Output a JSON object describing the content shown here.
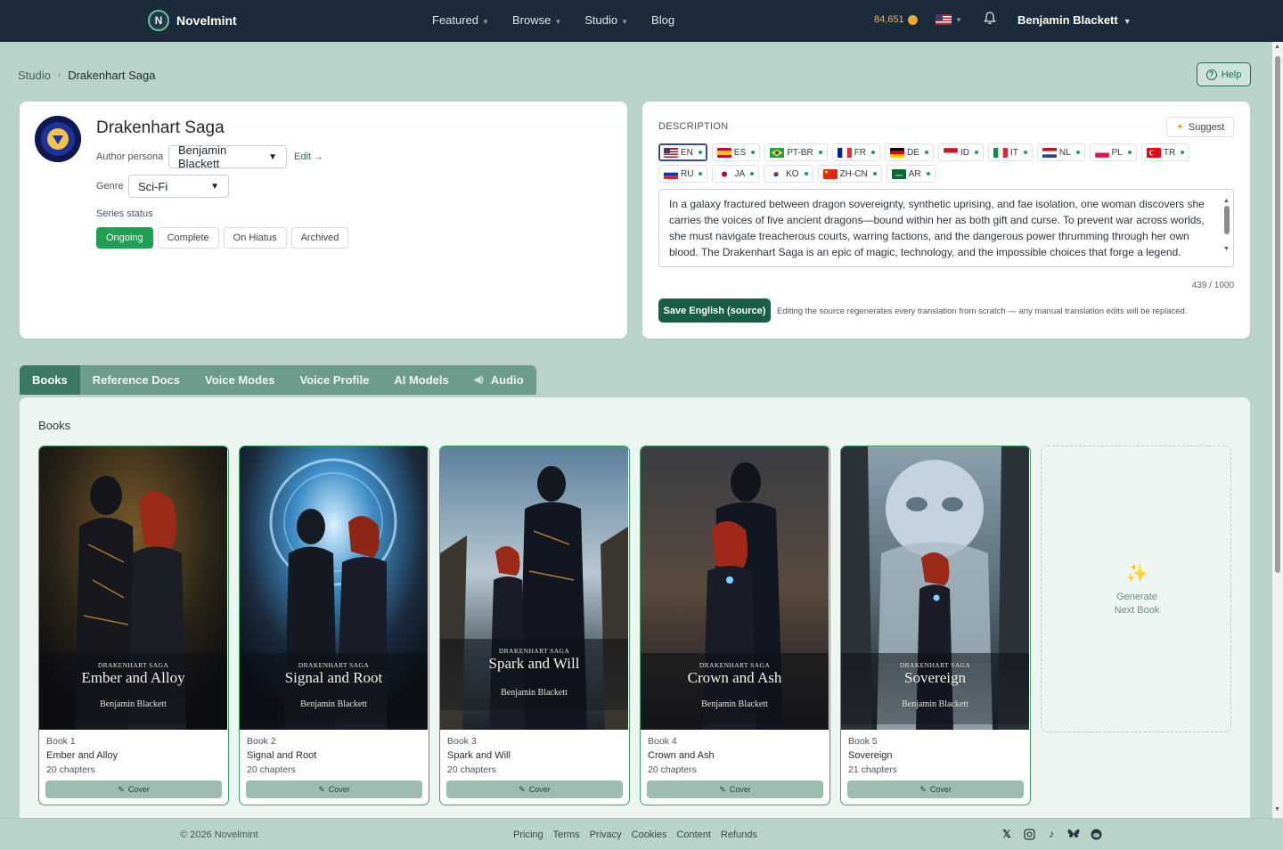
{
  "app": {
    "brand": "Novelmint",
    "logo_letter": "N"
  },
  "nav": {
    "links": [
      {
        "label": "Featured",
        "has_menu": true
      },
      {
        "label": "Browse",
        "has_menu": true
      },
      {
        "label": "Studio",
        "has_menu": true
      },
      {
        "label": "Blog",
        "has_menu": false
      }
    ],
    "coins": "84,651",
    "user": "Benjamin Blackett"
  },
  "breadcrumb": {
    "parent": "Studio",
    "current": "Drakenhart Saga"
  },
  "help_label": "Help",
  "series": {
    "title": "Drakenhart Saga",
    "author_persona_label": "Author persona",
    "author_persona_value": "Benjamin Blackett",
    "edit_label": "Edit →",
    "genre_label": "Genre",
    "genre_value": "Sci-Fi",
    "status_label": "Series status",
    "statuses": [
      "Ongoing",
      "Complete",
      "On Hiatus",
      "Archived"
    ],
    "active_status": "Ongoing"
  },
  "description": {
    "label": "DESCRIPTION",
    "suggest_label": "Suggest",
    "languages_row1": [
      "EN",
      "ES",
      "PT-BR",
      "FR",
      "DE",
      "ID",
      "IT",
      "NL",
      "PL",
      "TR"
    ],
    "languages_row2": [
      "RU",
      "JA",
      "KO",
      "ZH-CN",
      "AR"
    ],
    "active_language": "EN",
    "text": "In a galaxy fractured between dragon sovereignty, synthetic uprising, and fae isolation, one woman discovers she carries the voices of five ancient dragons—bound within her as both gift and curse. To prevent war across worlds, she must navigate treacherous courts, warring factions, and the dangerous power thrumming through her own blood. The Drakenhart Saga is an epic of magic, technology, and the impossible choices that forge a legend.",
    "char_count": "439 / 1000",
    "save_label": "Save English (source)",
    "save_note": "Editing the source regenerates every translation from scratch — any manual translation edits will be replaced."
  },
  "tabs": [
    "Books",
    "Reference Docs",
    "Voice Modes",
    "Voice Profile",
    "AI Models",
    "Audio"
  ],
  "active_tab": "Books",
  "books_heading": "Books",
  "books": [
    {
      "number": "Book 1",
      "title": "Ember and Alloy",
      "chapters": "20 chapters",
      "cover_saga": "DRAKENHART SAGA",
      "cover_title": "Ember and Alloy",
      "cover_author": "Benjamin Blackett"
    },
    {
      "number": "Book 2",
      "title": "Signal and Root",
      "chapters": "20 chapters",
      "cover_saga": "DRAKENHART SAGA",
      "cover_title": "Signal and Root",
      "cover_author": "Benjamin Blackett"
    },
    {
      "number": "Book 3",
      "title": "Spark and Will",
      "chapters": "20 chapters",
      "cover_saga": "DRAKENHART SAGA",
      "cover_title": "Spark and Will",
      "cover_author": "Benjamin Blackett"
    },
    {
      "number": "Book 4",
      "title": "Crown and Ash",
      "chapters": "20 chapters",
      "cover_saga": "DRAKENHART SAGA",
      "cover_title": "Crown and Ash",
      "cover_author": "Benjamin Blackett"
    },
    {
      "number": "Book 5",
      "title": "Sovereign",
      "chapters": "21 chapters",
      "cover_saga": "DRAKENHART SAGA",
      "cover_title": "Sovereign",
      "cover_author": "Benjamin Blackett"
    }
  ],
  "cover_button_label": "Cover",
  "generate": {
    "line1": "Generate",
    "line2": "Next Book"
  },
  "footer": {
    "copyright": "© 2026 Novelmint",
    "links": [
      "Pricing",
      "Terms",
      "Privacy",
      "Cookies",
      "Content",
      "Refunds"
    ],
    "socials": [
      "x-icon",
      "instagram-icon",
      "tiktok-icon",
      "bluesky-icon",
      "reddit-icon"
    ]
  }
}
